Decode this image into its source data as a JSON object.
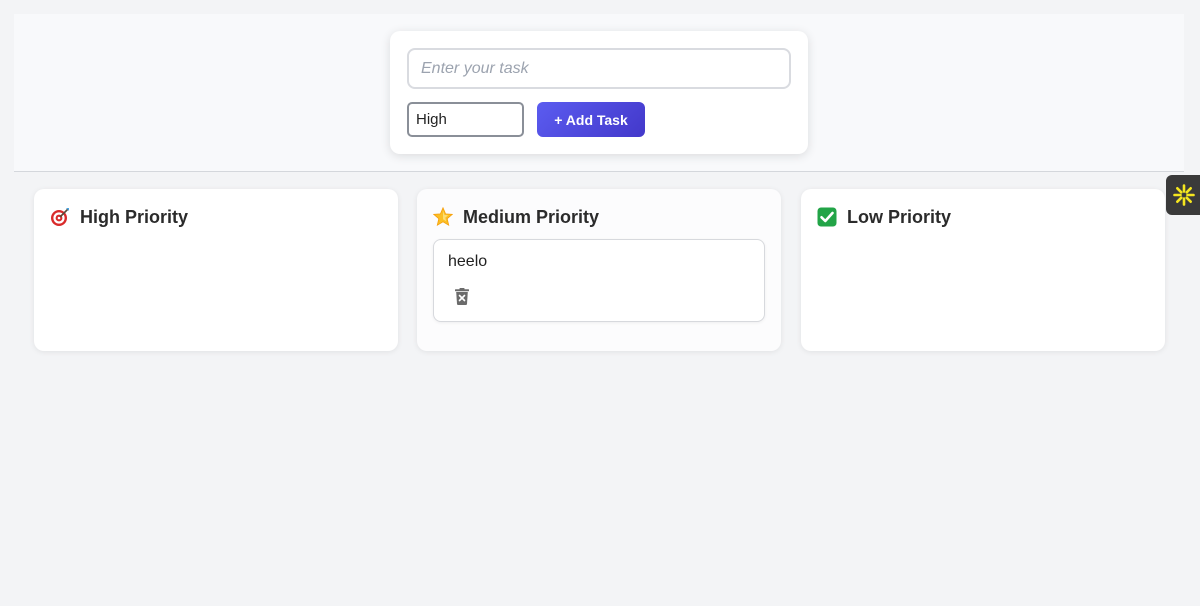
{
  "form": {
    "input_value": "",
    "input_placeholder": "Enter your task",
    "priority_selected": "High",
    "add_button_label": "+ Add Task"
  },
  "columns": [
    {
      "title": "High Priority",
      "icon": "target-icon",
      "tasks": []
    },
    {
      "title": "Medium Priority",
      "icon": "star-icon",
      "tasks": [
        {
          "text": "heelo",
          "action_icon": "trash-icon"
        }
      ]
    },
    {
      "title": "Low Priority",
      "icon": "check-box-icon",
      "tasks": []
    }
  ],
  "widget": {
    "icon": "asterisk-icon"
  },
  "colors": {
    "accent": "#4f46e5",
    "background": "#f3f4f6",
    "card": "#ffffff",
    "check_green": "#16a34a",
    "widget_yellow": "#f5e61f"
  }
}
